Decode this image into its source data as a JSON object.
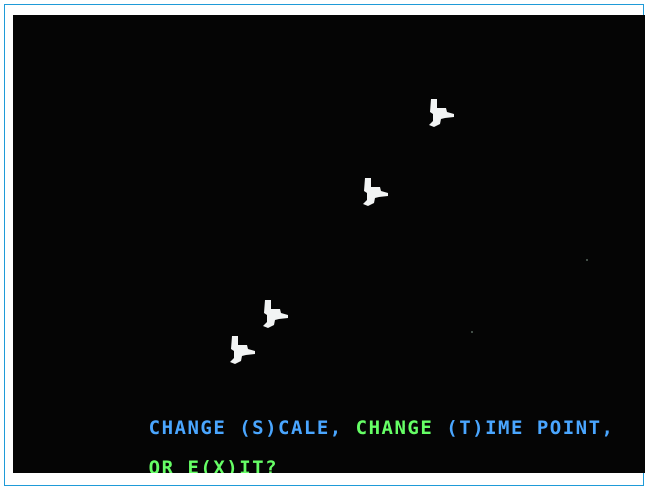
{
  "screen": {
    "background_color": "#050505",
    "sprite_color": "#f2f4f4",
    "sprite_icon": "bird-icon",
    "sprite_count": 4
  },
  "prompt": {
    "line1": [
      {
        "text": "CHANGE (S)CALE, ",
        "color": "#4aa6ff"
      },
      {
        "text": "CHANGE ",
        "color": "#66ff66"
      },
      {
        "text": "(T)IME POINT, ",
        "color": "#4aa6ff"
      }
    ],
    "line1_seg1": "CHANGE (S)CALE, ",
    "line1_seg2": "CHANGE ",
    "line1_seg3": "(T)IME POINT,",
    "line2_seg1": "OR E(X)IT?"
  }
}
